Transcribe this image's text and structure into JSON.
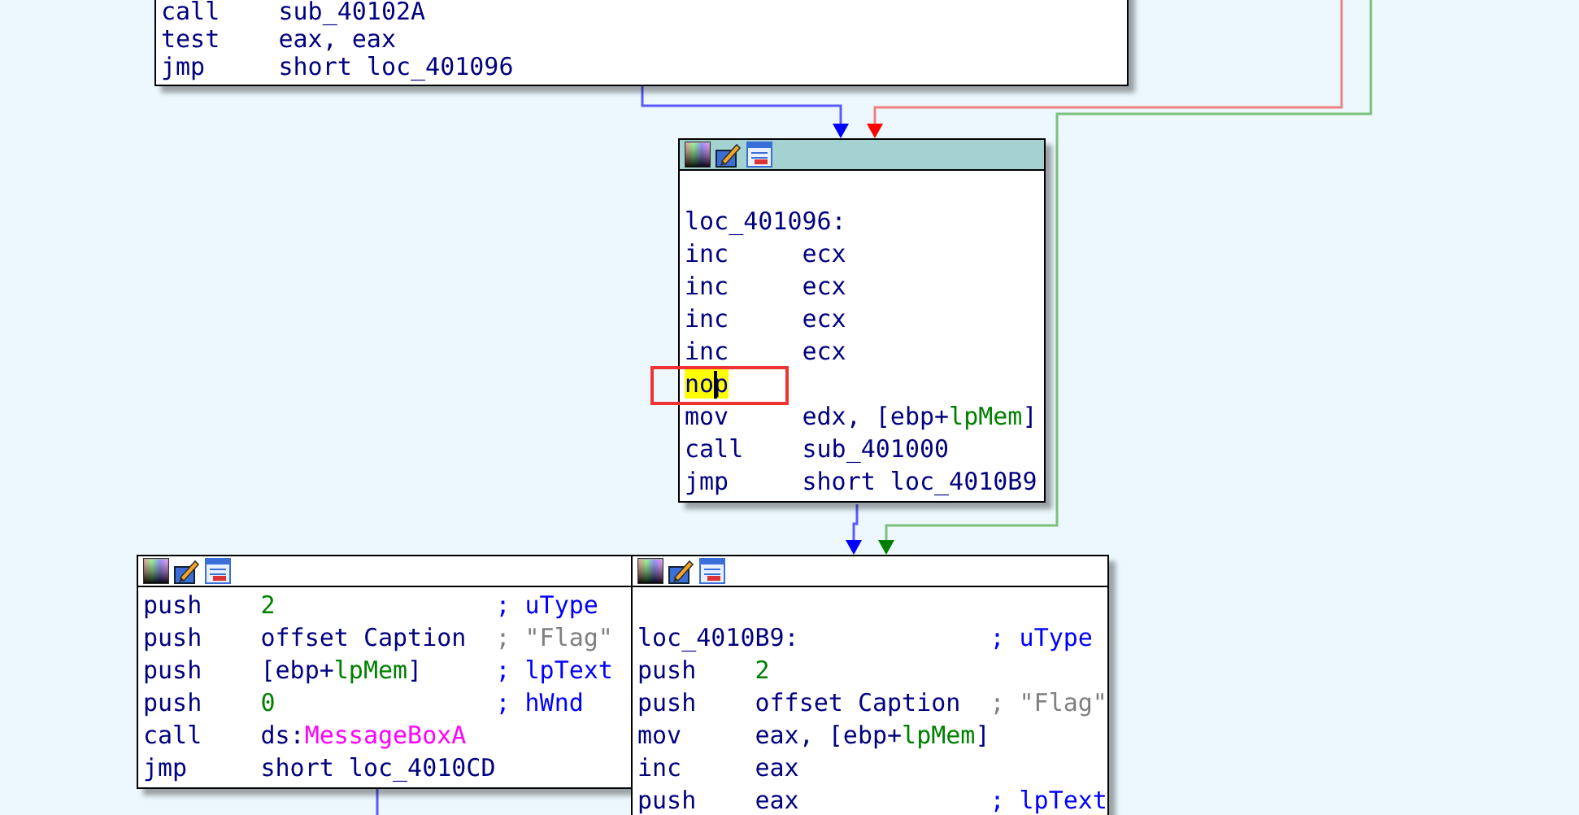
{
  "blocks": [
    {
      "lines": [
        {
          "kind": "instr",
          "mnemonic": "call",
          "operand": [
            {
              "text": "sub_40102A",
              "kind": "plain"
            }
          ]
        },
        {
          "kind": "instr",
          "mnemonic": "test",
          "operand": [
            {
              "text": "eax, eax",
              "kind": "plain"
            }
          ]
        },
        {
          "kind": "instr",
          "mnemonic": "jmp",
          "operand": [
            {
              "text": "short loc_401096",
              "kind": "plain"
            }
          ]
        }
      ]
    },
    {
      "selected": true,
      "lines": [
        {
          "kind": "label",
          "text": "loc_401096:"
        },
        {
          "kind": "instr",
          "mnemonic": "inc",
          "operand": [
            {
              "text": "ecx",
              "kind": "plain"
            }
          ]
        },
        {
          "kind": "instr",
          "mnemonic": "inc",
          "operand": [
            {
              "text": "ecx",
              "kind": "plain"
            }
          ]
        },
        {
          "kind": "instr",
          "mnemonic": "inc",
          "operand": [
            {
              "text": "ecx",
              "kind": "plain"
            }
          ]
        },
        {
          "kind": "instr",
          "mnemonic": "inc",
          "operand": [
            {
              "text": "ecx",
              "kind": "plain"
            }
          ]
        },
        {
          "kind": "instr",
          "mnemonic": "nop",
          "highlighted": true
        },
        {
          "kind": "instr",
          "mnemonic": "mov",
          "operand": [
            {
              "text": "edx, [ebp+",
              "kind": "plain"
            },
            {
              "text": "lpMem",
              "kind": "var"
            },
            {
              "text": "]",
              "kind": "plain"
            }
          ]
        },
        {
          "kind": "instr",
          "mnemonic": "call",
          "operand": [
            {
              "text": "sub_401000",
              "kind": "plain"
            }
          ]
        },
        {
          "kind": "instr",
          "mnemonic": "jmp",
          "operand": [
            {
              "text": "short loc_4010B9",
              "kind": "plain"
            }
          ]
        }
      ]
    },
    {
      "selected": false,
      "lines": [
        {
          "kind": "instr",
          "mnemonic": "push",
          "operand": [
            {
              "text": "2",
              "kind": "number"
            }
          ],
          "comment": {
            "text": "; uType",
            "kind": "name"
          }
        },
        {
          "kind": "instr",
          "mnemonic": "push",
          "operand": [
            {
              "text": "offset Caption",
              "kind": "plain"
            }
          ],
          "comment": {
            "text": "; \"Flag\"",
            "kind": "string"
          }
        },
        {
          "kind": "instr",
          "mnemonic": "push",
          "operand": [
            {
              "text": "[ebp+",
              "kind": "plain"
            },
            {
              "text": "lpMem",
              "kind": "var"
            },
            {
              "text": "]",
              "kind": "plain"
            }
          ],
          "comment": {
            "text": "; lpText",
            "kind": "name"
          }
        },
        {
          "kind": "instr",
          "mnemonic": "push",
          "operand": [
            {
              "text": "0",
              "kind": "number"
            }
          ],
          "comment": {
            "text": "; hWnd",
            "kind": "name"
          }
        },
        {
          "kind": "instr",
          "mnemonic": "call",
          "operand": [
            {
              "text": "ds:",
              "kind": "plain"
            },
            {
              "text": "MessageBoxA",
              "kind": "import"
            }
          ]
        },
        {
          "kind": "instr",
          "mnemonic": "jmp",
          "operand": [
            {
              "text": "short loc_4010CD",
              "kind": "plain"
            }
          ]
        }
      ]
    },
    {
      "selected": false,
      "lines": [
        {
          "kind": "label",
          "text": "loc_4010B9:",
          "comment": {
            "text": "; uType",
            "kind": "name"
          }
        },
        {
          "kind": "instr",
          "mnemonic": "push",
          "operand": [
            {
              "text": "2",
              "kind": "number"
            }
          ]
        },
        {
          "kind": "instr",
          "mnemonic": "push",
          "operand": [
            {
              "text": "offset Caption",
              "kind": "plain"
            }
          ],
          "comment": {
            "text": "; \"Flag\"",
            "kind": "string"
          }
        },
        {
          "kind": "instr",
          "mnemonic": "mov",
          "operand": [
            {
              "text": "eax, [ebp+",
              "kind": "plain"
            },
            {
              "text": "lpMem",
              "kind": "var"
            },
            {
              "text": "]",
              "kind": "plain"
            }
          ]
        },
        {
          "kind": "instr",
          "mnemonic": "inc",
          "operand": [
            {
              "text": "eax",
              "kind": "plain"
            }
          ]
        },
        {
          "kind": "instr",
          "mnemonic": "push",
          "operand": [
            {
              "text": "eax",
              "kind": "plain"
            }
          ],
          "comment": {
            "text": "; lpText",
            "kind": "name"
          }
        }
      ]
    }
  ]
}
